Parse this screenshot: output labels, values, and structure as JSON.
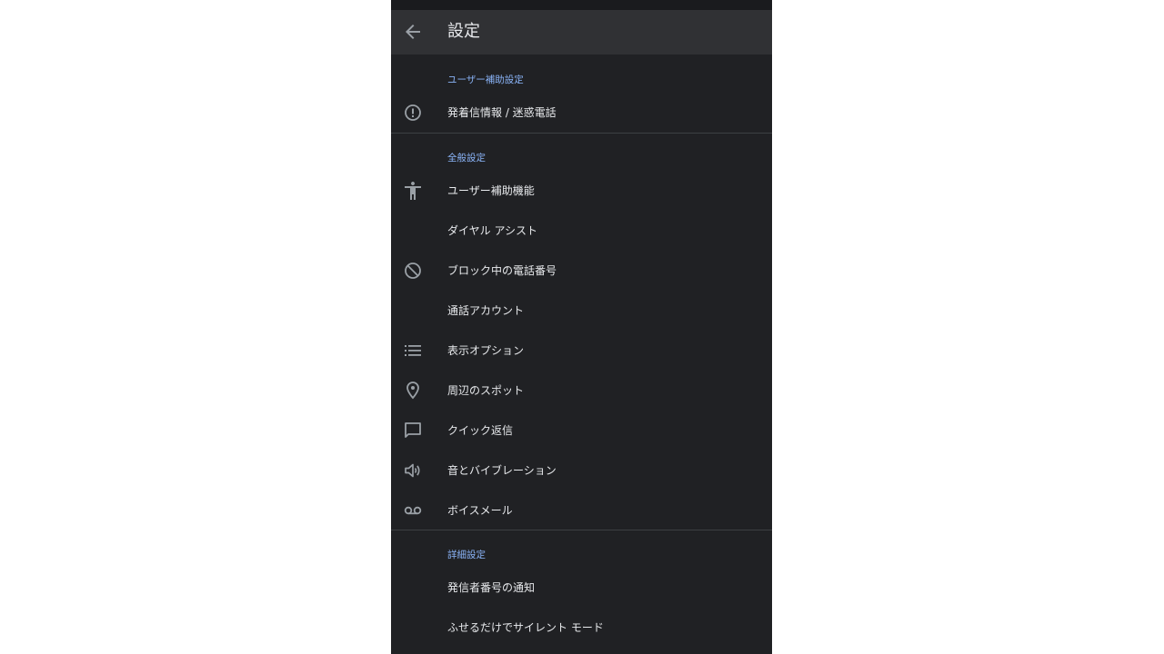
{
  "header": {
    "title": "設定",
    "back_icon": "arrow-back-icon"
  },
  "colors": {
    "background": "#202124",
    "app_bar": "#303134",
    "accent": "#8ab4f8",
    "text": "#e8eaed",
    "icon": "#9aa0a6",
    "divider": "#3c4043"
  },
  "sections": [
    {
      "header": "ユーザー補助設定",
      "items": [
        {
          "label": "発着信情報 / 迷惑電話",
          "icon": "alert-circle-icon"
        }
      ]
    },
    {
      "header": "全般設定",
      "items": [
        {
          "label": "ユーザー補助機能",
          "icon": "accessibility-icon"
        },
        {
          "label": "ダイヤル アシスト",
          "icon": ""
        },
        {
          "label": "ブロック中の電話番号",
          "icon": "block-icon"
        },
        {
          "label": "通話アカウント",
          "icon": ""
        },
        {
          "label": "表示オプション",
          "icon": "list-icon"
        },
        {
          "label": "周辺のスポット",
          "icon": "location-pin-icon"
        },
        {
          "label": "クイック返信",
          "icon": "chat-bubble-icon"
        },
        {
          "label": "音とバイブレーション",
          "icon": "volume-icon"
        },
        {
          "label": "ボイスメール",
          "icon": "voicemail-icon"
        }
      ]
    },
    {
      "header": "詳細設定",
      "items": [
        {
          "label": "発信者番号の通知",
          "icon": ""
        },
        {
          "label": "ふせるだけでサイレント モード",
          "icon": ""
        }
      ]
    }
  ]
}
